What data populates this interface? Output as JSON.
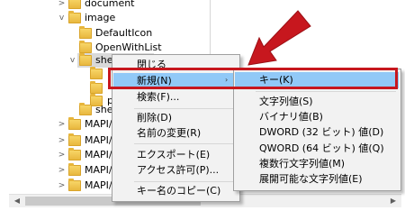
{
  "tree": {
    "items": [
      {
        "label": "document",
        "chevron": ">"
      },
      {
        "label": "image",
        "chevron": "v"
      },
      {
        "label": "DefaultIcon",
        "chevron": ""
      },
      {
        "label": "OpenWithList",
        "chevron": ""
      },
      {
        "label": "shell",
        "chevron": "v"
      },
      {
        "label": "",
        "chevron": ""
      },
      {
        "label": "",
        "chevron": ""
      },
      {
        "label": "p",
        "chevron": ""
      },
      {
        "label": "shell",
        "chevron": ""
      },
      {
        "label": "MAPI/A",
        "chevron": ">"
      },
      {
        "label": "MAPI/I",
        "chevron": ">"
      },
      {
        "label": "MAPI/I",
        "chevron": ">"
      },
      {
        "label": "MAPI/I",
        "chevron": ">"
      },
      {
        "label": "MAPI/I",
        "chevron": ">"
      }
    ]
  },
  "context_menu": {
    "close": "閉じる",
    "new": "新規(N)",
    "find": "検索(F)...",
    "delete": "削除(D)",
    "rename": "名前の変更(R)",
    "export": "エクスポート(E)",
    "permissions": "アクセス許可(P)...",
    "copy_key_name": "キー名のコピー(C)"
  },
  "submenu": {
    "key": "キー(K)",
    "string_value": "文字列値(S)",
    "binary_value": "バイナリ値(B)",
    "dword_value": "DWORD (32 ビット) 値(D)",
    "qword_value": "QWORD (64 ビット) 値(Q)",
    "multi_string_value": "複数行文字列値(M)",
    "expandable_string_value": "展開可能な文字列値(E)"
  },
  "colors": {
    "annotation": "#c7171e",
    "highlight": "#91c9f7"
  }
}
